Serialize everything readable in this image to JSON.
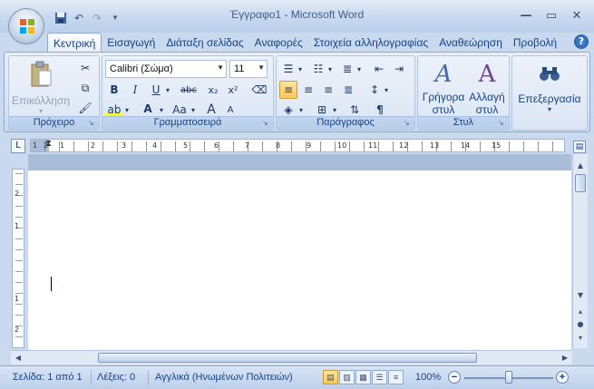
{
  "window": {
    "title": "Έγγραφο1 - Microsoft Word",
    "controls": {
      "minimize_icon": "minimize-icon",
      "maximize_icon": "restore-icon",
      "close_icon": "close-icon"
    }
  },
  "quick_access": {
    "items": [
      {
        "icon": "save-icon"
      },
      {
        "icon": "undo-icon"
      },
      {
        "icon": "redo-icon"
      },
      {
        "icon": "customize-qat-icon"
      }
    ]
  },
  "tabs": [
    {
      "label": "Κεντρική",
      "active": true
    },
    {
      "label": "Εισαγωγή"
    },
    {
      "label": "Διάταξη σελίδας"
    },
    {
      "label": "Αναφορές"
    },
    {
      "label": "Στοιχεία αλληλογραφίας"
    },
    {
      "label": "Αναθεώρηση"
    },
    {
      "label": "Προβολή"
    }
  ],
  "help_label": "?",
  "ribbon": {
    "clipboard": {
      "label": "Πρόχειρο",
      "paste_label": "Επικόλληση"
    },
    "font": {
      "label": "Γραμματοσειρά",
      "font_name": "Calibri (Σώμα)",
      "font_size": "11",
      "bold": "B",
      "italic": "I",
      "underline": "U",
      "strikethrough": "abc",
      "subscript": "x₂",
      "superscript": "x²",
      "change_case": "Aa",
      "grow": "A",
      "shrink": "A"
    },
    "paragraph": {
      "label": "Παράγραφος",
      "pilcrow": "¶"
    },
    "styles": {
      "label": "Στυλ",
      "quick_styles": [
        "Γρήγορα",
        "στυλ"
      ],
      "change_styles": [
        "Αλλαγή",
        "στυλ"
      ]
    },
    "editing": {
      "label": "Επεξεργασία"
    }
  },
  "ruler": {
    "numbers": [
      "1",
      "2",
      "1",
      "2",
      "3",
      "4",
      "5",
      "6",
      "7",
      "8",
      "9",
      "10",
      "11",
      "12",
      "13",
      "14",
      "15"
    ],
    "vertical_numbers": [
      "2",
      "1",
      "1",
      "2"
    ]
  },
  "statusbar": {
    "page": "Σελίδα: 1 από 1",
    "words": "Λέξεις: 0",
    "language": "Αγγλικά (Ηνωμένων Πολιτειών)",
    "zoom": "100%",
    "zoom_out": "−",
    "zoom_in": "+",
    "zoom_level": 0.5
  },
  "colors": {
    "accent": "#15428b",
    "ribbon": "#dbe6f5",
    "selected": "#ffc85a"
  }
}
